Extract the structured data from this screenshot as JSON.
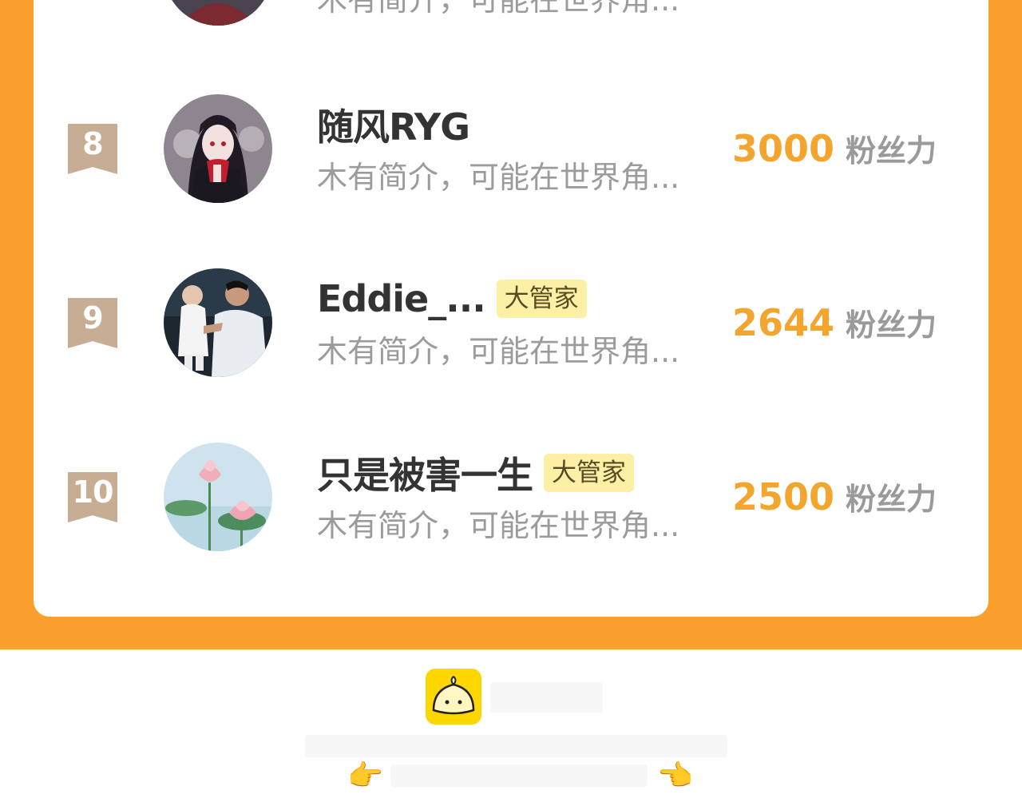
{
  "leaderboard": {
    "partial_row": {
      "bio": "木有简介，可能在世界角..."
    },
    "rows": [
      {
        "rank": "8",
        "name": "随风RYG",
        "tag": "",
        "bio": "木有简介，可能在世界角...",
        "score": "3000",
        "unit": "粉丝力",
        "avatar": "anime-girl-avatar"
      },
      {
        "rank": "9",
        "name": "Eddie_...",
        "tag": "大管家",
        "bio": "木有简介，可能在世界角...",
        "score": "2644",
        "unit": "粉丝力",
        "avatar": "father-baby-photo-avatar"
      },
      {
        "rank": "10",
        "name": "只是被害一生",
        "tag": "大管家",
        "bio": "木有简介，可能在世界角...",
        "score": "2500",
        "unit": "粉丝力",
        "avatar": "lotus-flower-avatar"
      }
    ]
  },
  "footer": {
    "logo": "bun-mascot-logo",
    "left_pointer": "👉",
    "right_pointer": "👈"
  },
  "colors": {
    "brand_orange": "#fb9f2d",
    "score": "#f2a630",
    "tag_bg": "#fcefa6",
    "badge": "#c8ad95"
  }
}
